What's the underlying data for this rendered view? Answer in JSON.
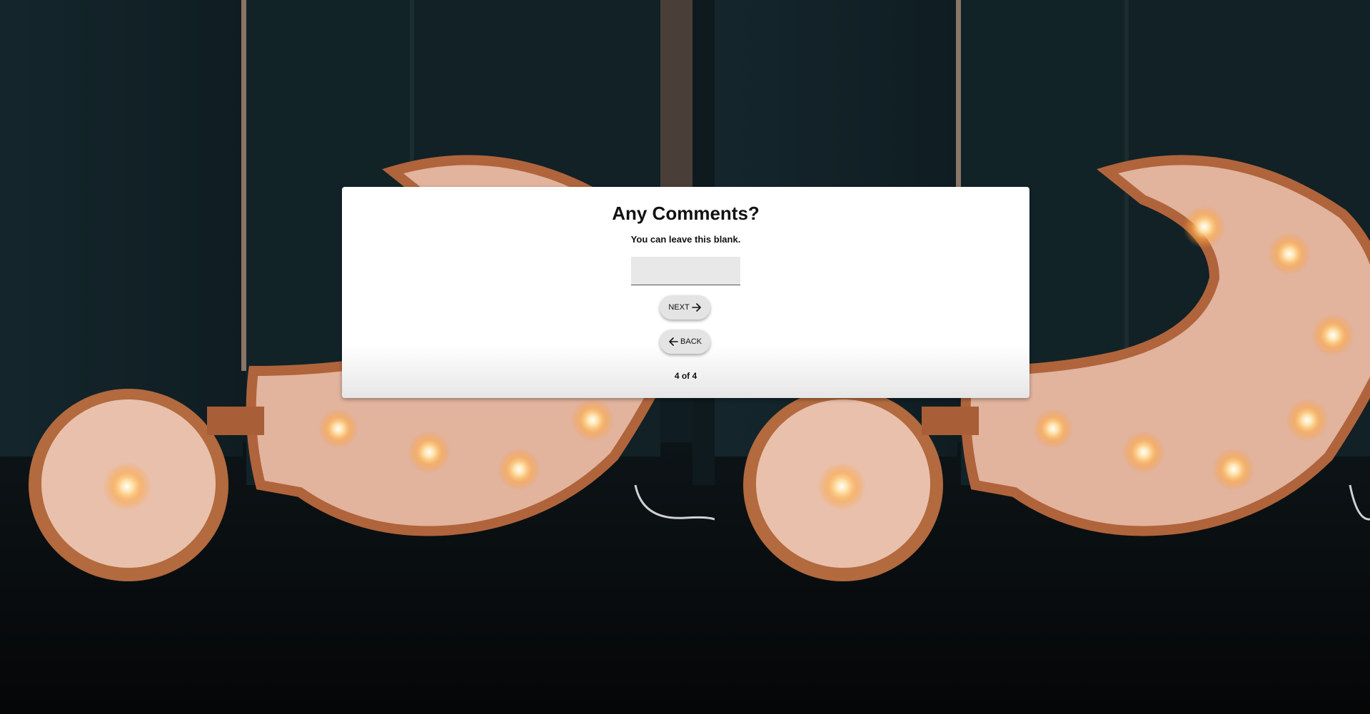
{
  "form": {
    "title": "Any Comments?",
    "subtitle": "You can leave this blank.",
    "comment_value": "",
    "next_label": "NEXT",
    "back_label": "BACK",
    "progress": "4 of 4"
  },
  "icons": {
    "next": "arrow-right-icon",
    "back": "arrow-left-icon"
  },
  "colors": {
    "card_background": "#ffffff",
    "button_background": "#e4e4e4",
    "input_background": "#e8e8e8",
    "text": "#111111"
  }
}
